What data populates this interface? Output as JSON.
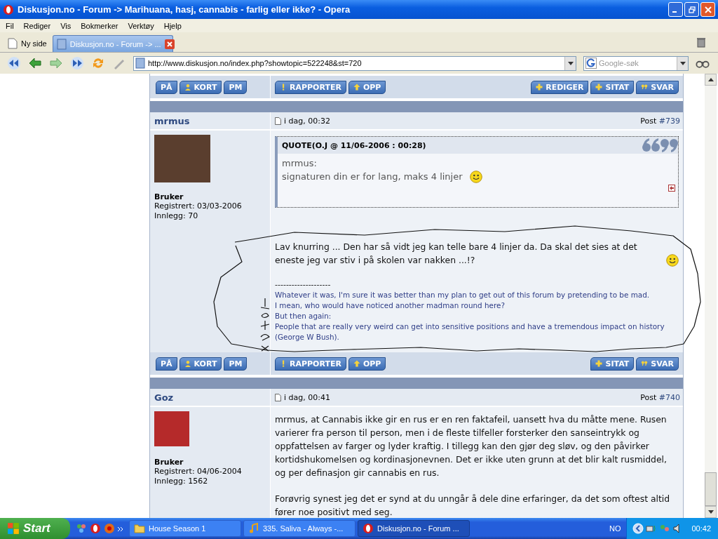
{
  "window": {
    "title": "Diskusjon.no - Forum -> Marihuana, hasj, cannabis - farlig eller ikke? - Opera"
  },
  "menu": [
    "Fil",
    "Rediger",
    "Vis",
    "Bokmerker",
    "Verktøy",
    "Hjelp"
  ],
  "tabs": [
    {
      "label": "Ny side",
      "selected": false,
      "kind": "new"
    },
    {
      "label": "Diskusjon.no - Forum -> ...",
      "selected": true,
      "kind": "page"
    }
  ],
  "address": {
    "url": "http://www.diskusjon.no/index.php?showtopic=522248&st=720"
  },
  "search": {
    "placeholder": "Google-søk"
  },
  "top_actions": {
    "left": [
      {
        "label": "PÅ",
        "kind": "plain"
      },
      {
        "label": "KORT",
        "kind": "user"
      },
      {
        "label": "PM",
        "kind": "plain"
      }
    ],
    "middle": [
      {
        "label": "RAPPORTER",
        "kind": "report"
      },
      {
        "label": "OPP",
        "kind": "up"
      }
    ],
    "right": [
      {
        "label": "REDIGER",
        "kind": "add"
      },
      {
        "label": "SITAT",
        "kind": "add"
      },
      {
        "label": "SVAR",
        "kind": "reply"
      }
    ]
  },
  "posts": [
    {
      "author": "mrmus",
      "date": "i dag, 00:32",
      "post_label": "Post",
      "post_number": "#739",
      "role": "Bruker",
      "registered": "Registrert: 03/03-2006",
      "count": "Innlegg: 70",
      "quote": {
        "header": "QUOTE(O.J @ 11/06-2006 : 00:28)",
        "lines": [
          {
            "text": "mrmus:",
            "smiley": false
          },
          {
            "text": "signaturen din er for lang, maks 4 linjer",
            "smiley": true
          }
        ]
      },
      "paragraphs": [
        {
          "text": "Lav knurring ... Den har så vidt jeg kan telle bare 4 linjer da. Da skal det sies at det eneste jeg var stiv i på skolen var nakken ...!?",
          "smiley": true
        }
      ],
      "signature": {
        "rule": "--------------------",
        "lines": [
          "Whatever it was, I'm sure it was better than my plan to get out of this forum by pretending to be mad.",
          "I mean, who would have noticed another madman round here?",
          "But then again:",
          "People that are really very weird can get into sensitive positions and have a tremendous impact on history (George W Bush)."
        ]
      },
      "actions": {
        "left": [
          {
            "label": "PÅ",
            "kind": "plain"
          },
          {
            "label": "KORT",
            "kind": "user"
          },
          {
            "label": "PM",
            "kind": "plain"
          }
        ],
        "middle": [
          {
            "label": "RAPPORTER",
            "kind": "report"
          },
          {
            "label": "OPP",
            "kind": "up"
          }
        ],
        "right": [
          {
            "label": "SITAT",
            "kind": "add"
          },
          {
            "label": "SVAR",
            "kind": "reply"
          }
        ]
      }
    },
    {
      "author": "Goz",
      "date": "i dag, 00:41",
      "post_label": "Post",
      "post_number": "#740",
      "role": "Bruker",
      "registered": "Registrert: 04/06-2004",
      "count": "Innlegg: 1562",
      "paragraphs": [
        {
          "text": "mrmus, at Cannabis ikke gir en rus er en ren faktafeil, uansett hva du måtte mene. Rusen varierer fra person til person, men i de fleste tilfeller forsterker den sanseintrykk og oppfattelsen av farger og lyder kraftig. I tillegg kan den gjør deg sløv, og den påvirker kortidshukomelsen og kordinasjonevnen. Det er ikke uten grunn at det blir kalt rusmiddel, og per definasjon gir cannabis en rus.",
          "smiley": false
        },
        {
          "text": "Forøvrig synest jeg det er synd at du unngår å dele dine erfaringer, da det som oftest altid fører noe positivt med seg.",
          "smiley": false
        }
      ]
    }
  ],
  "taskbar": {
    "start": "Start",
    "tasks": [
      {
        "label": "House Season 1",
        "kind": "folder",
        "selected": false
      },
      {
        "label": "335. Saliva - Always -...",
        "kind": "player",
        "selected": false
      },
      {
        "label": "Diskusjon.no - Forum ...",
        "kind": "opera",
        "selected": true
      }
    ],
    "language": "NO",
    "time": "00:42"
  }
}
